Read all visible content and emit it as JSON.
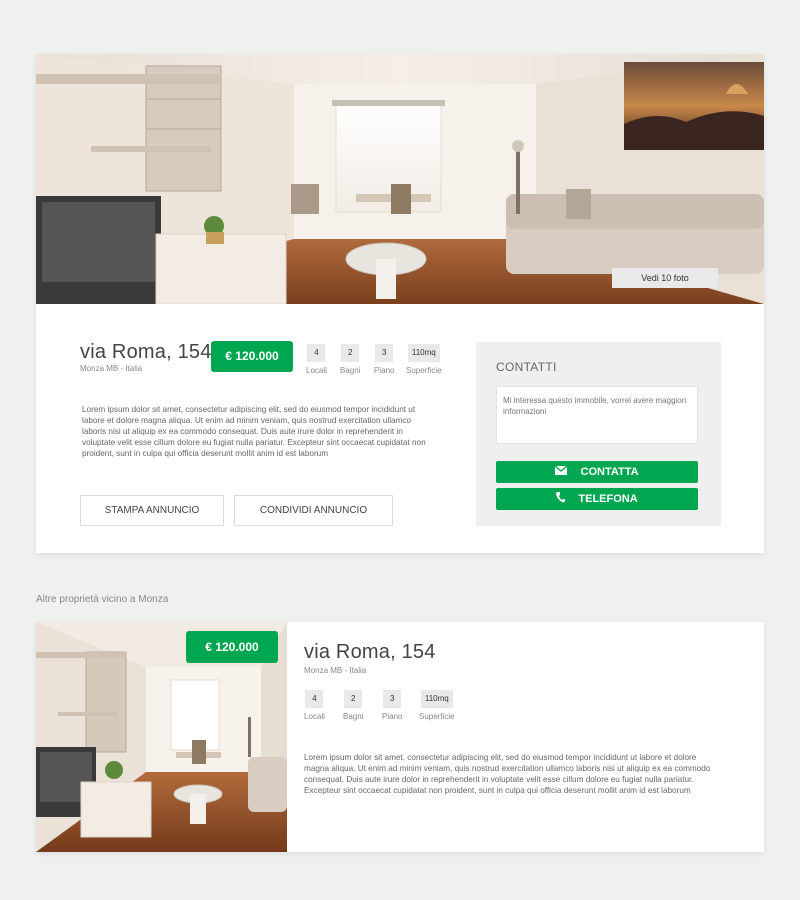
{
  "listing": {
    "photos_button": "Vedi 10 foto",
    "address": "via Roma, 154",
    "location": "Monza MB - Italia",
    "price": "€ 120.000",
    "features": [
      {
        "value": "4",
        "label": "Locali"
      },
      {
        "value": "2",
        "label": "Bagni"
      },
      {
        "value": "3",
        "label": "Piano"
      },
      {
        "value": "110mq",
        "label": "Superficie"
      }
    ],
    "description": "Lorem ipsum dolor sit amet, consectetur adipiscing elit, sed do eiusmod tempor incididunt ut labore et dolore magna aliqua. Ut enim ad minim veniam, quis nostrud exercitation ullamco laboris nisi ut aliquip ex ea commodo consequat. Duis aute irure dolor in reprehenderit in voluptate velit esse cillum dolore eu fugiat nulla pariatur. Excepteur sint occaecat cupidatat non proident, sunt in culpa qui officia deserunt mollit anim id est laborum",
    "print_button": "STAMPA ANNUNCIO",
    "share_button": "CONDIVIDI ANNUNCIO"
  },
  "contact": {
    "title": "CONTATTI",
    "message": "Mi interessa questo immobile, vorrei avere maggiori informazioni",
    "contact_button": "CONTATTA",
    "contact_icon": "envelope-icon",
    "phone_button": "TELEFONA",
    "phone_icon": "phone-icon"
  },
  "nearby": {
    "title": "Altre proprietà vicino a Monza",
    "items": [
      {
        "price": "€ 120.000",
        "address": "via Roma, 154",
        "location": "Monza MB - Italia",
        "features": [
          {
            "value": "4",
            "label": "Locali"
          },
          {
            "value": "2",
            "label": "Bagni"
          },
          {
            "value": "3",
            "label": "Piano"
          },
          {
            "value": "110mq",
            "label": "Superficie"
          }
        ],
        "description": "Lorem ipsum dolor sit amet, consectetur adipiscing elit, sed do eiusmod tempor incididunt ut labore et dolore magna aliqua. Ut enim ad minim veniam, quis nostrud exercitation ullamco laboris nisi ut aliquip ex ea commodo consequat. Duis aute irure dolor in reprehenderit in voluptate velit esse cillum dolore eu fugiat nulla pariatur. Excepteur sint occaecat cupidatat non proident, sunt in culpa qui officia deserunt mollit anim id est laborum"
      }
    ]
  },
  "colors": {
    "accent": "#00a650",
    "background": "#eff1f1",
    "chip": "#e9e9e9"
  }
}
